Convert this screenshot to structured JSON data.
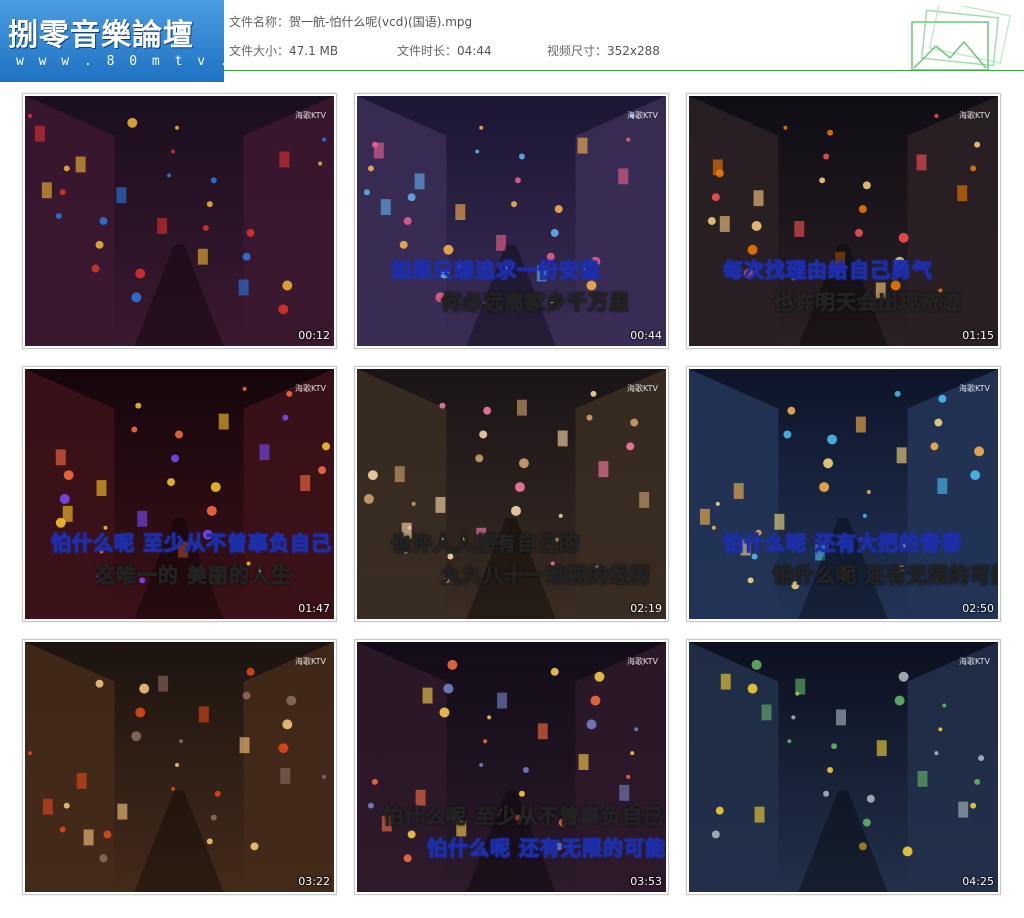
{
  "logo": {
    "title": "捌零音樂論壇",
    "url": "w w w . 8 0 m t v . c o m"
  },
  "file": {
    "name_label": "文件名称：",
    "name": "贺一航-怕什么呢(vcd)(国语).mpg",
    "size_label": "文件大小：",
    "size": "47.1 MB",
    "duration_label": "文件时长：",
    "duration": "04:44",
    "dims_label": "视频尺寸：",
    "dims": "352x288"
  },
  "icons": {
    "thumbnail": "image-gallery-icon"
  },
  "thumbnails": [
    {
      "timestamp": "00:12",
      "watermark": "海歌KTV",
      "lyrics": []
    },
    {
      "timestamp": "00:44",
      "watermark": "海歌KTV",
      "lyrics": [
        {
          "text": "如果只想追求一份安稳",
          "style": "sung"
        },
        {
          "text": "何必远离家乡千万里",
          "style": "unsung"
        }
      ]
    },
    {
      "timestamp": "01:15",
      "watermark": "海歌KTV",
      "lyrics": [
        {
          "text": "每次找理由给自己勇气",
          "style": "sung"
        },
        {
          "text": "也许明天会出现奇迹",
          "style": "unsung"
        }
      ]
    },
    {
      "timestamp": "01:47",
      "watermark": "海歌KTV",
      "lyrics": [
        {
          "text": "怕什么呢 至少从不曾辜负自己",
          "style": "sung"
        },
        {
          "text": "这唯一的 美丽的人生",
          "style": "unsung"
        }
      ]
    },
    {
      "timestamp": "02:19",
      "watermark": "海歌KTV",
      "lyrics": [
        {
          "text": "也许人人都有自己的",
          "style": "unsung"
        },
        {
          "text": "九九八十一难要的经历",
          "style": "unsung"
        }
      ]
    },
    {
      "timestamp": "02:50",
      "watermark": "海歌KTV",
      "lyrics": [
        {
          "text": "怕什么呢 还有大把的青春",
          "style": "sung"
        },
        {
          "text": "怕什么呢 还有无限的可能",
          "style": "unsung"
        }
      ]
    },
    {
      "timestamp": "03:22",
      "watermark": "海歌KTV",
      "lyrics": []
    },
    {
      "timestamp": "03:53",
      "watermark": "海歌KTV",
      "lyrics": [
        {
          "text": "怕什么呢 至少从不曾辜负自己",
          "style": "unsung"
        },
        {
          "text": "怕什么呢 还有无限的可能",
          "style": "sung"
        }
      ]
    },
    {
      "timestamp": "04:25",
      "watermark": "海歌KTV",
      "lyrics": []
    }
  ]
}
